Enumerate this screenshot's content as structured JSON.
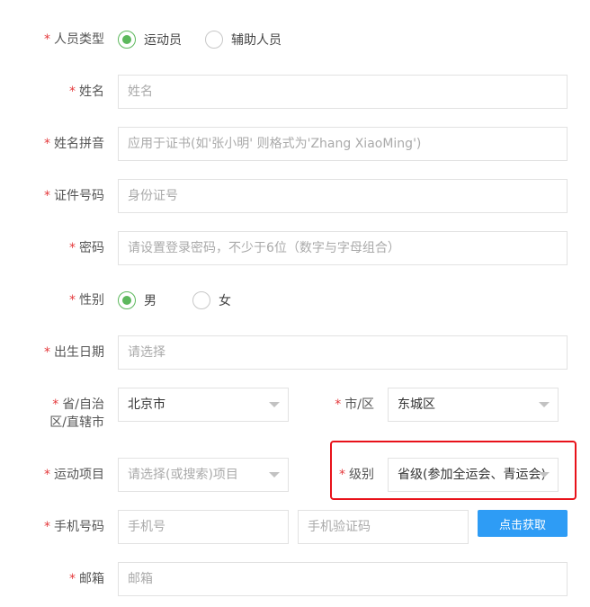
{
  "form": {
    "person_type": {
      "label": "人员类型",
      "options": [
        {
          "label": "运动员",
          "checked": true
        },
        {
          "label": "辅助人员",
          "checked": false
        }
      ]
    },
    "name": {
      "label": "姓名",
      "placeholder": "姓名"
    },
    "pinyin": {
      "label": "姓名拼音",
      "placeholder": "应用于证书(如'张小明' 则格式为'Zhang XiaoMing')"
    },
    "id_number": {
      "label": "证件号码",
      "placeholder": "身份证号"
    },
    "password": {
      "label": "密码",
      "placeholder": "请设置登录密码，不少于6位（数字与字母组合）"
    },
    "gender": {
      "label": "性别",
      "options": [
        {
          "label": "男",
          "checked": true
        },
        {
          "label": "女",
          "checked": false
        }
      ]
    },
    "birth_date": {
      "label": "出生日期",
      "placeholder": "请选择"
    },
    "province": {
      "label_line1": "省/自治",
      "label_line2": "区/直辖市",
      "value": "北京市"
    },
    "city": {
      "label": "市/区",
      "value": "东城区"
    },
    "sport": {
      "label": "运动项目",
      "placeholder": "请选择(或搜索)项目"
    },
    "level": {
      "label": "级别",
      "value": "省级(参加全运会、青运会)"
    },
    "phone": {
      "label": "手机号码",
      "placeholder": "手机号",
      "code_placeholder": "手机验证码",
      "get_code_button": "点击获取"
    },
    "email": {
      "label": "邮箱",
      "placeholder": "邮箱"
    },
    "required_mark": "*"
  },
  "colors": {
    "accent_green": "#5cb85c",
    "required_red": "#e4393c",
    "button_blue": "#2e9cf5",
    "highlight_red": "#e8121a"
  }
}
